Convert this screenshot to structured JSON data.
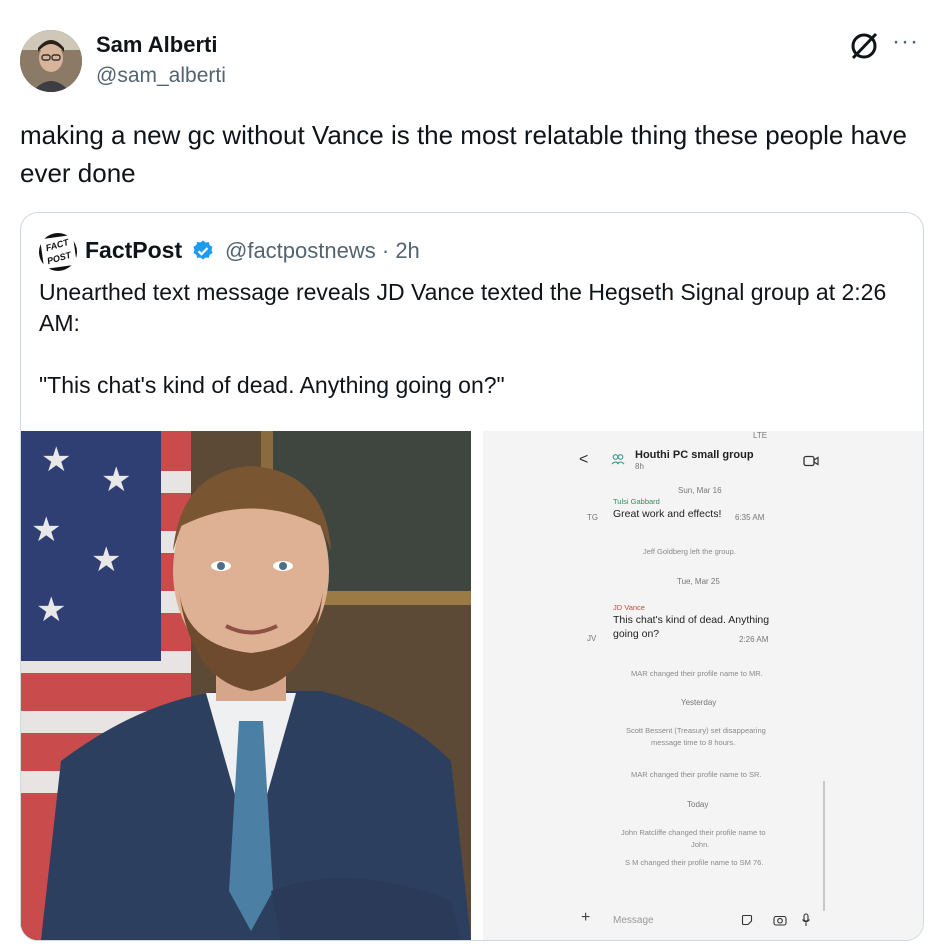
{
  "author": {
    "name": "Sam Alberti",
    "handle": "@sam_alberti"
  },
  "tweet": {
    "text": "making a new gc without Vance is the most relatable thing these people have ever done"
  },
  "icons": {
    "grok": "grok-icon",
    "more": "···"
  },
  "quote": {
    "name": "FactPost",
    "logo_text_1": "FACT",
    "logo_text_2": "POST",
    "handle": "@factpostnews",
    "separator": "·",
    "time": "2h",
    "text": "Unearthed text message reveals JD Vance texted the Hegseth Signal group at 2:26 AM:\n\n\"This chat's kind of dead. Anything going on?\"",
    "verified_color": "#1d9bf0"
  },
  "signal": {
    "status_bar": "LTE",
    "back": "<",
    "group_name": "Houthi PC small group",
    "group_sub": "8h",
    "date_1": "Sun, Mar 16",
    "sender_1": "Tulsi Gabbard",
    "initials_1": "TG",
    "message_1": "Great work and effects!",
    "time_1": "6:35 AM",
    "event_1": "Jeff Goldberg left the group.",
    "date_2": "Tue, Mar 25",
    "sender_2": "JD Vance",
    "initials_2": "JV",
    "message_2_line1": "This chat's kind of dead. Anything",
    "message_2_line2": "going on?",
    "time_2": "2:26 AM",
    "event_2": "MAR changed their profile name to MR.",
    "date_3": "Yesterday",
    "event_3_line1": "Scott Bessent (Treasury) set disappearing",
    "event_3_line2": "message time to 8 hours.",
    "event_4": "MAR changed their profile name to SR.",
    "date_4": "Today",
    "event_5_line1": "John Ratcliffe changed their profile name to",
    "event_5_line2": "John.",
    "event_6": "S M changed their profile name to SM 76.",
    "input_placeholder": "Message",
    "plus": "+"
  }
}
